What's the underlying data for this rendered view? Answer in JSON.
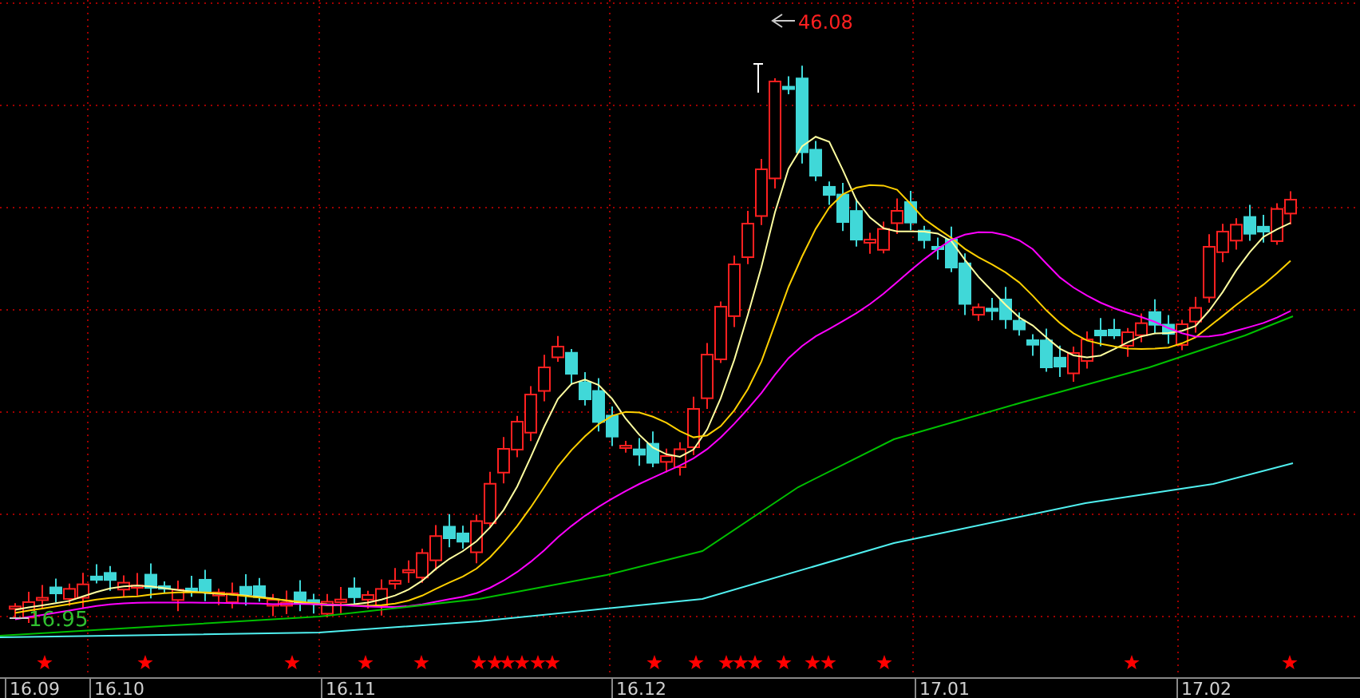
{
  "chart": {
    "high_price_label": "46.08",
    "low_price_label": "16.95"
  },
  "time_axis": {
    "labels": [
      "16.09",
      "16.10",
      "16.11",
      "16.12",
      "17.01",
      "17.02"
    ]
  }
}
